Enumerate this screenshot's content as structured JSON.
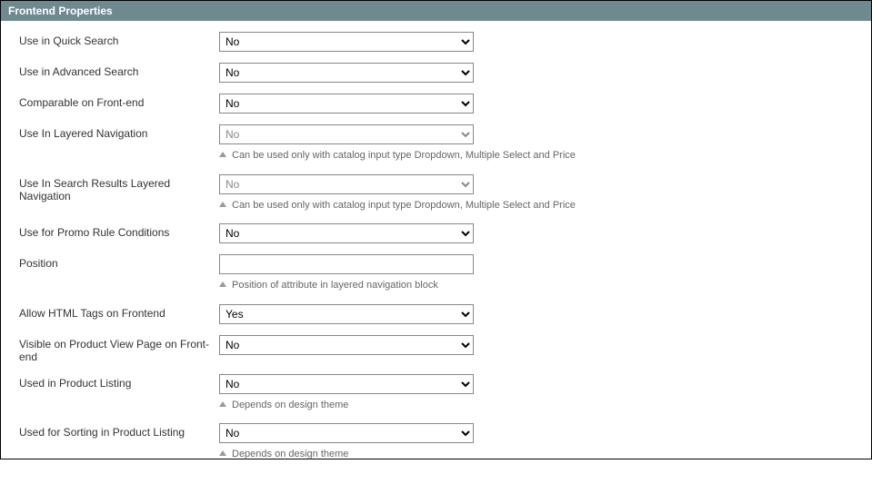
{
  "header": {
    "title": "Frontend Properties"
  },
  "fields": {
    "quick_search": {
      "label": "Use in Quick Search",
      "value": "No"
    },
    "advanced_search": {
      "label": "Use in Advanced Search",
      "value": "No"
    },
    "comparable": {
      "label": "Comparable on Front-end",
      "value": "No"
    },
    "layered_nav": {
      "label": "Use In Layered Navigation",
      "value": "No",
      "hint": "Can be used only with catalog input type Dropdown, Multiple Select and Price"
    },
    "search_layered": {
      "label": "Use In Search Results Layered Navigation",
      "value": "No",
      "hint": "Can be used only with catalog input type Dropdown, Multiple Select and Price"
    },
    "promo_rule": {
      "label": "Use for Promo Rule Conditions",
      "value": "No"
    },
    "position": {
      "label": "Position",
      "value": "",
      "hint": "Position of attribute in layered navigation block"
    },
    "allow_html": {
      "label": "Allow HTML Tags on Frontend",
      "value": "Yes"
    },
    "visible_pvp": {
      "label": "Visible on Product View Page on Front-end",
      "value": "No"
    },
    "product_listing": {
      "label": "Used in Product Listing",
      "value": "No",
      "hint": "Depends on design theme"
    },
    "sorting": {
      "label": "Used for Sorting in Product Listing",
      "value": "No",
      "hint": "Depends on design theme"
    }
  },
  "options": {
    "yes": "Yes",
    "no": "No"
  }
}
